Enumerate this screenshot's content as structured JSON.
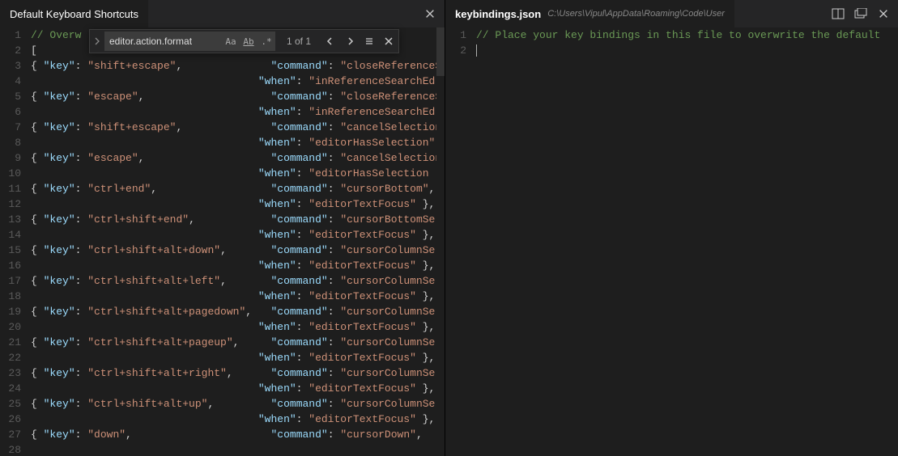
{
  "left": {
    "tab_title": "Default Keyboard Shortcuts",
    "find": {
      "value": "editor.action.format",
      "case_label": "Aa",
      "word_label": "Ab",
      "regex_label": ".*",
      "count": "1 of 1"
    },
    "lines": [
      {
        "n": 1,
        "type": "comment",
        "text": "// Overw"
      },
      {
        "n": 2,
        "type": "open",
        "text": "["
      },
      {
        "n": 3,
        "type": "entry",
        "key": "shift+escape",
        "command": "closeReferenceSearch"
      },
      {
        "n": 4,
        "type": "when",
        "when": "inReferenceSearchEd"
      },
      {
        "n": 5,
        "type": "entry",
        "key": "escape",
        "command": "closeReferenceSearch"
      },
      {
        "n": 6,
        "type": "when",
        "when": "inReferenceSearchEd"
      },
      {
        "n": 7,
        "type": "entry",
        "key": "shift+escape",
        "command": "cancelSelection",
        "trail": ","
      },
      {
        "n": 8,
        "type": "when",
        "when": "editorHasSelection",
        "trail": ","
      },
      {
        "n": 9,
        "type": "entry",
        "key": "escape",
        "command": "cancelSelection",
        "trail": ","
      },
      {
        "n": 10,
        "type": "when",
        "when": "editorHasSelection "
      },
      {
        "n": 11,
        "type": "entry",
        "key": "ctrl+end",
        "command": "cursorBottom",
        "trail": ","
      },
      {
        "n": 12,
        "type": "when",
        "when": "editorTextFocus",
        "trail": " },"
      },
      {
        "n": 13,
        "type": "entry",
        "key": "ctrl+shift+end",
        "command": "cursorBottomSelect"
      },
      {
        "n": 14,
        "type": "when",
        "when": "editorTextFocus",
        "trail": " },"
      },
      {
        "n": 15,
        "type": "entry",
        "key": "ctrl+shift+alt+down",
        "command": "cursorColumnSelectD"
      },
      {
        "n": 16,
        "type": "when",
        "when": "editorTextFocus",
        "trail": " },"
      },
      {
        "n": 17,
        "type": "entry",
        "key": "ctrl+shift+alt+left",
        "command": "cursorColumnSelectL"
      },
      {
        "n": 18,
        "type": "when",
        "when": "editorTextFocus",
        "trail": " },"
      },
      {
        "n": 19,
        "type": "entry",
        "key": "ctrl+shift+alt+pagedown",
        "command": "cursorColumnSelect"
      },
      {
        "n": 20,
        "type": "when",
        "when": "editorTextFocus",
        "trail": " },"
      },
      {
        "n": 21,
        "type": "entry",
        "key": "ctrl+shift+alt+pageup",
        "command": "cursorColumnSelectP"
      },
      {
        "n": 22,
        "type": "when",
        "when": "editorTextFocus",
        "trail": " },"
      },
      {
        "n": 23,
        "type": "entry",
        "key": "ctrl+shift+alt+right",
        "command": "cursorColumnSelectR"
      },
      {
        "n": 24,
        "type": "when",
        "when": "editorTextFocus",
        "trail": " },"
      },
      {
        "n": 25,
        "type": "entry",
        "key": "ctrl+shift+alt+up",
        "command": "cursorColumnSelectU"
      },
      {
        "n": 26,
        "type": "when",
        "when": "editorTextFocus",
        "trail": " },"
      },
      {
        "n": 27,
        "type": "entry",
        "key": "down",
        "command": "cursorDown",
        "trail": ","
      },
      {
        "n": 28,
        "type": "blank"
      }
    ]
  },
  "right": {
    "tab_title": "keybindings.json",
    "tab_path": "C:\\Users\\Vipul\\AppData\\Roaming\\Code\\User",
    "lines": [
      {
        "n": 1,
        "type": "comment",
        "text": "// Place your key bindings in this file to overwrite the default"
      },
      {
        "n": 2,
        "type": "cursor"
      }
    ]
  }
}
